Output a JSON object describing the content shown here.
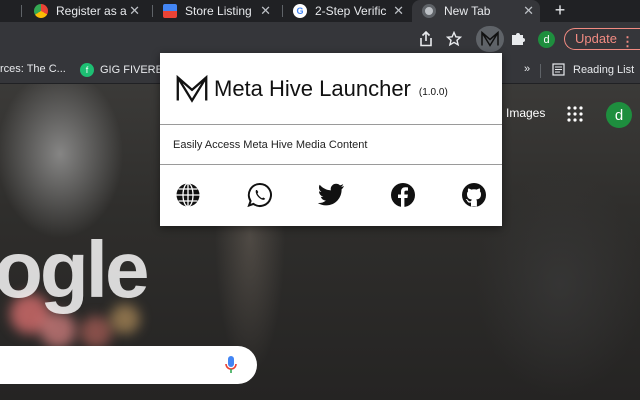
{
  "tabs": [
    {
      "title": "Register as a ",
      "favicon": "chrome-icon"
    },
    {
      "title": "Store Listing",
      "favicon": "webstore-icon"
    },
    {
      "title": "2-Step Verific",
      "favicon": "google-icon"
    },
    {
      "title": "New Tab",
      "favicon": "new-tab-icon",
      "active": true
    }
  ],
  "toolbar": {
    "update_label": "Update",
    "profile_initial": "d"
  },
  "bookmarks": [
    {
      "label": "rces: The C..."
    },
    {
      "label": "GIG FIVERE"
    },
    {
      "label": "Reading List"
    }
  ],
  "newtab_page": {
    "images_link": "Images",
    "profile_initial": "d",
    "logo_fragment": "ogle"
  },
  "popup": {
    "title": "Meta Hive Launcher",
    "version": "(1.0.0)",
    "description": "Easily Access Meta Hive Media Content",
    "links": [
      "globe-icon",
      "whatsapp-icon",
      "twitter-icon",
      "facebook-icon",
      "github-icon"
    ]
  },
  "colors": {
    "update_accent": "#f28b82",
    "profile_green": "#1e8e3e",
    "tab_bar": "#202124",
    "toolbar": "#35363a"
  }
}
